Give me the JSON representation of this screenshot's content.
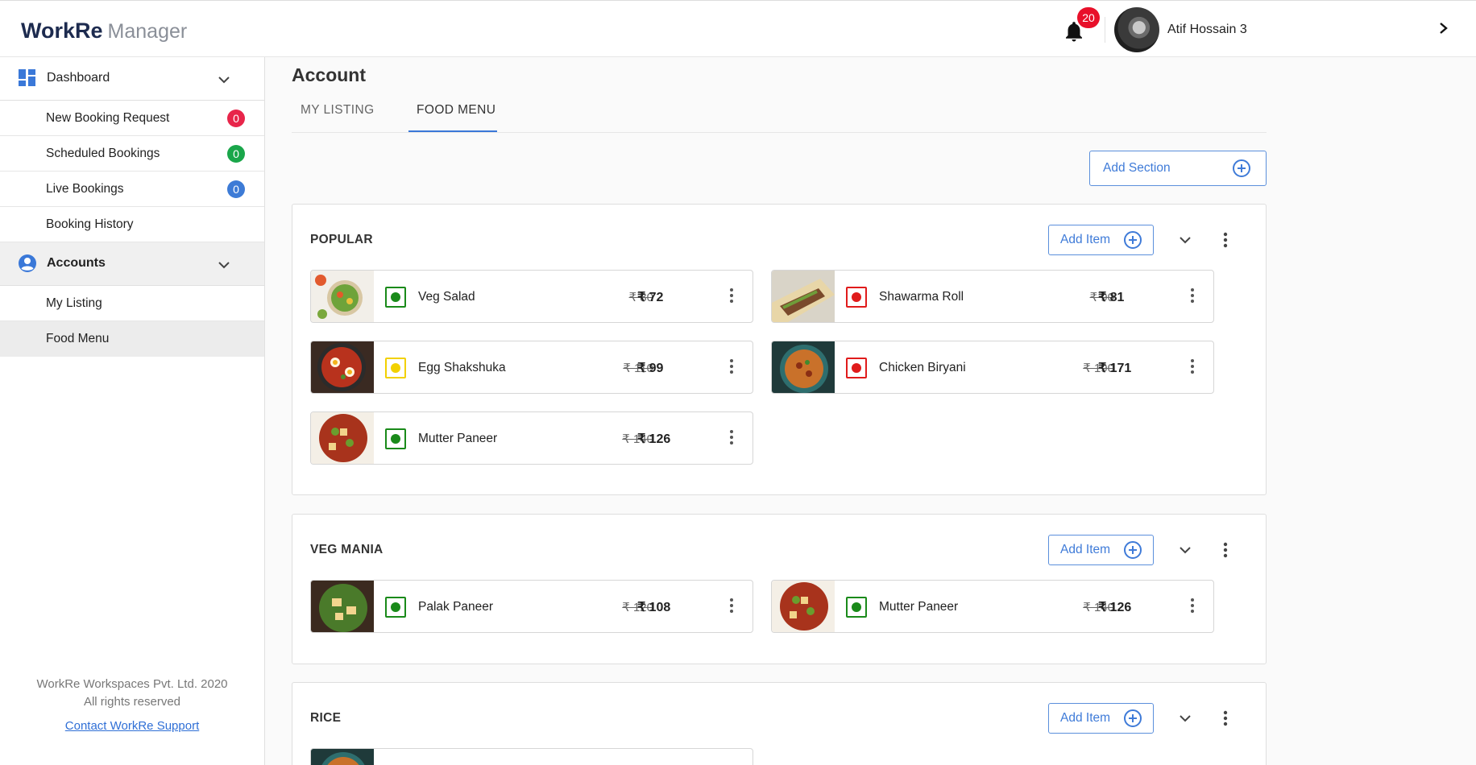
{
  "app": {
    "brand": "WorkRe",
    "subtitle": "Manager"
  },
  "header": {
    "notification_count": "20",
    "user_name": "Atif Hossain 3"
  },
  "sidebar": {
    "dashboard_label": "Dashboard",
    "items": [
      {
        "label": "New Booking Request",
        "count": "0",
        "color": "#e8254a"
      },
      {
        "label": "Scheduled Bookings",
        "count": "0",
        "color": "#1aa64a"
      },
      {
        "label": "Live Bookings",
        "count": "0",
        "color": "#3d7bd6"
      },
      {
        "label": "Booking History"
      }
    ],
    "accounts_label": "Accounts",
    "account_items": [
      {
        "label": "My Listing"
      },
      {
        "label": "Food Menu"
      }
    ],
    "footer_line1": "WorkRe Workspaces Pvt. Ltd. 2020",
    "footer_line2": "All rights reserved",
    "support_link": "Contact WorkRe Support"
  },
  "main": {
    "title": "Account",
    "tabs": [
      {
        "label": "MY LISTING"
      },
      {
        "label": "FOOD MENU"
      }
    ],
    "active_tab": "FOOD MENU",
    "add_section_label": "Add Section",
    "add_item_label": "Add Item",
    "sections": [
      {
        "title": "POPULAR",
        "items": [
          {
            "name": "Veg Salad",
            "old_price": "₹ 80",
            "price": "₹ 72",
            "diet": "veg"
          },
          {
            "name": "Shawarma Roll",
            "old_price": "₹ 90",
            "price": "₹ 81",
            "diet": "non-veg"
          },
          {
            "name": "Egg Shakshuka",
            "old_price": "₹ 110",
            "price": "₹ 99",
            "diet": "egg"
          },
          {
            "name": "Chicken Biryani",
            "old_price": "₹ 190",
            "price": "₹ 171",
            "diet": "non-veg"
          },
          {
            "name": "Mutter Paneer",
            "old_price": "₹ 140",
            "price": "₹ 126",
            "diet": "veg"
          }
        ]
      },
      {
        "title": "VEG MANIA",
        "items": [
          {
            "name": "Palak Paneer",
            "old_price": "₹ 120",
            "price": "₹ 108",
            "diet": "veg"
          },
          {
            "name": "Mutter Paneer",
            "old_price": "₹ 140",
            "price": "₹ 126",
            "diet": "veg"
          }
        ]
      },
      {
        "title": "RICE",
        "items": []
      }
    ]
  },
  "colors": {
    "accent": "#3a78d8",
    "veg": "#1a8a1a",
    "non_veg": "#e01b1b",
    "egg": "#f2d100"
  }
}
